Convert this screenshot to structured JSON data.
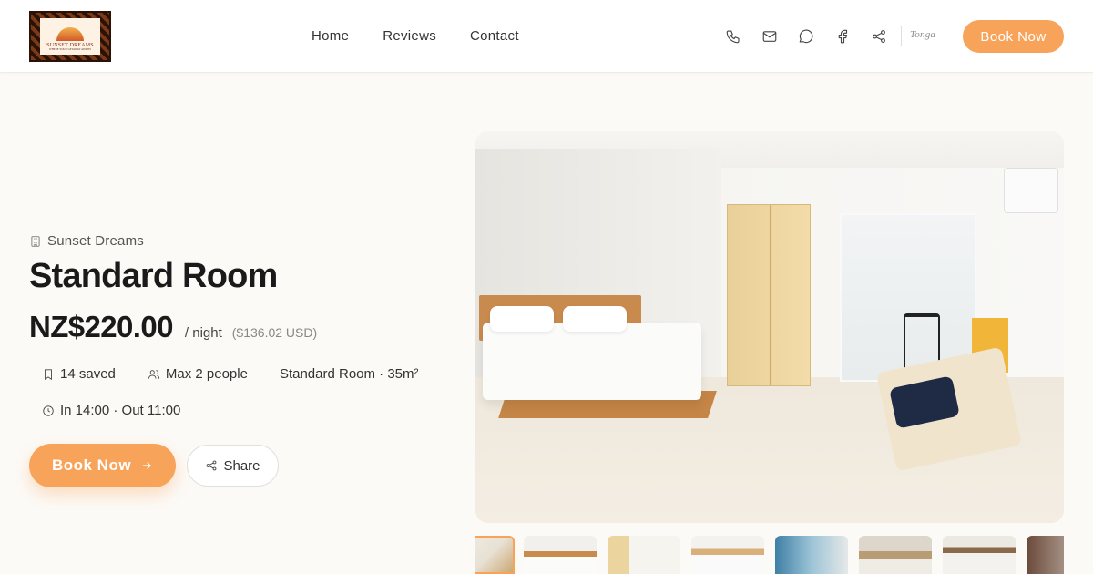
{
  "header": {
    "logo": {
      "name": "SUNSET DREAMS",
      "tagline": "WHERE YOUR GETAWAY AWAITS"
    },
    "nav": [
      "Home",
      "Reviews",
      "Contact"
    ],
    "icons": [
      "phone-icon",
      "mail-icon",
      "chat-icon",
      "facebook-icon",
      "share-icon"
    ],
    "partner_logo": "Tonga",
    "book_label": "Book Now"
  },
  "hero": {
    "property_name": "Sunset Dreams",
    "room_title": "Standard Room",
    "price": "NZ$220.00",
    "per_night": "/ night",
    "usd_price": "($136.02 USD)",
    "saved": "14 saved",
    "max_people": "Max 2 people",
    "room_info": "Standard Room · 35m²",
    "checkin": "In 14:00 · Out 11:00",
    "book_label": "Book Now",
    "share_label": "Share"
  },
  "gallery": {
    "thumbnail_count": 8,
    "active_index": 0
  },
  "colors": {
    "accent": "#f8a35a",
    "text": "#1a1a1a",
    "background": "#fcfaf7"
  }
}
